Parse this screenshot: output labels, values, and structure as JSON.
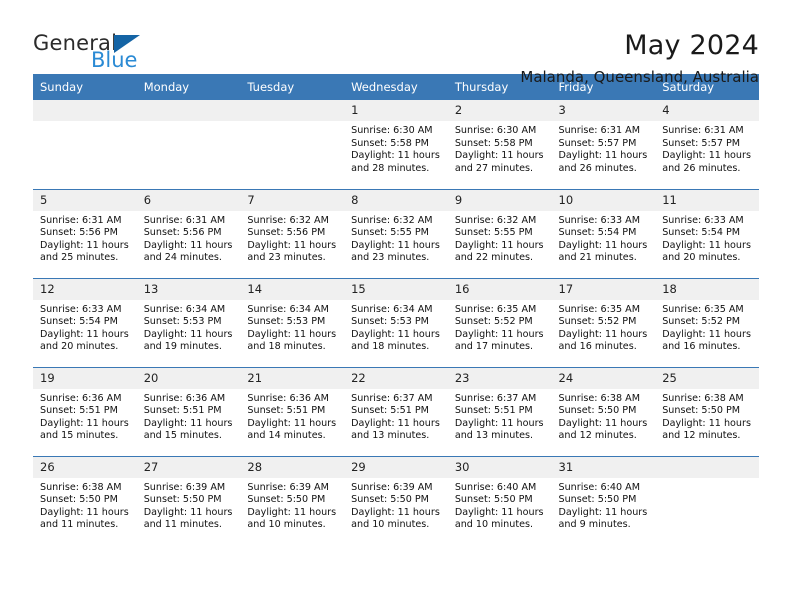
{
  "brand": {
    "name_top": "General",
    "name_bottom": "Blue",
    "triangle_color": "#1464a5",
    "blue_text_color": "#2a8ad4"
  },
  "header": {
    "title": "May 2024",
    "subtitle": "Malanda, Queensland, Australia",
    "header_bg": "#3a78b5",
    "daynum_bg": "#f0f0f0"
  },
  "weekday_headers": [
    "Sunday",
    "Monday",
    "Tuesday",
    "Wednesday",
    "Thursday",
    "Friday",
    "Saturday"
  ],
  "labels": {
    "sunrise_prefix": "Sunrise:",
    "sunset_prefix": "Sunset:",
    "daylight_prefix": "Daylight:"
  },
  "weeks": [
    [
      {
        "day": "",
        "empty": true
      },
      {
        "day": "",
        "empty": true
      },
      {
        "day": "",
        "empty": true
      },
      {
        "day": "1",
        "sunrise": "Sunrise: 6:30 AM",
        "sunset": "Sunset: 5:58 PM",
        "daylight_1": "Daylight: 11 hours",
        "daylight_2": "and 28 minutes."
      },
      {
        "day": "2",
        "sunrise": "Sunrise: 6:30 AM",
        "sunset": "Sunset: 5:58 PM",
        "daylight_1": "Daylight: 11 hours",
        "daylight_2": "and 27 minutes."
      },
      {
        "day": "3",
        "sunrise": "Sunrise: 6:31 AM",
        "sunset": "Sunset: 5:57 PM",
        "daylight_1": "Daylight: 11 hours",
        "daylight_2": "and 26 minutes."
      },
      {
        "day": "4",
        "sunrise": "Sunrise: 6:31 AM",
        "sunset": "Sunset: 5:57 PM",
        "daylight_1": "Daylight: 11 hours",
        "daylight_2": "and 26 minutes."
      }
    ],
    [
      {
        "day": "5",
        "sunrise": "Sunrise: 6:31 AM",
        "sunset": "Sunset: 5:56 PM",
        "daylight_1": "Daylight: 11 hours",
        "daylight_2": "and 25 minutes."
      },
      {
        "day": "6",
        "sunrise": "Sunrise: 6:31 AM",
        "sunset": "Sunset: 5:56 PM",
        "daylight_1": "Daylight: 11 hours",
        "daylight_2": "and 24 minutes."
      },
      {
        "day": "7",
        "sunrise": "Sunrise: 6:32 AM",
        "sunset": "Sunset: 5:56 PM",
        "daylight_1": "Daylight: 11 hours",
        "daylight_2": "and 23 minutes."
      },
      {
        "day": "8",
        "sunrise": "Sunrise: 6:32 AM",
        "sunset": "Sunset: 5:55 PM",
        "daylight_1": "Daylight: 11 hours",
        "daylight_2": "and 23 minutes."
      },
      {
        "day": "9",
        "sunrise": "Sunrise: 6:32 AM",
        "sunset": "Sunset: 5:55 PM",
        "daylight_1": "Daylight: 11 hours",
        "daylight_2": "and 22 minutes."
      },
      {
        "day": "10",
        "sunrise": "Sunrise: 6:33 AM",
        "sunset": "Sunset: 5:54 PM",
        "daylight_1": "Daylight: 11 hours",
        "daylight_2": "and 21 minutes."
      },
      {
        "day": "11",
        "sunrise": "Sunrise: 6:33 AM",
        "sunset": "Sunset: 5:54 PM",
        "daylight_1": "Daylight: 11 hours",
        "daylight_2": "and 20 minutes."
      }
    ],
    [
      {
        "day": "12",
        "sunrise": "Sunrise: 6:33 AM",
        "sunset": "Sunset: 5:54 PM",
        "daylight_1": "Daylight: 11 hours",
        "daylight_2": "and 20 minutes."
      },
      {
        "day": "13",
        "sunrise": "Sunrise: 6:34 AM",
        "sunset": "Sunset: 5:53 PM",
        "daylight_1": "Daylight: 11 hours",
        "daylight_2": "and 19 minutes."
      },
      {
        "day": "14",
        "sunrise": "Sunrise: 6:34 AM",
        "sunset": "Sunset: 5:53 PM",
        "daylight_1": "Daylight: 11 hours",
        "daylight_2": "and 18 minutes."
      },
      {
        "day": "15",
        "sunrise": "Sunrise: 6:34 AM",
        "sunset": "Sunset: 5:53 PM",
        "daylight_1": "Daylight: 11 hours",
        "daylight_2": "and 18 minutes."
      },
      {
        "day": "16",
        "sunrise": "Sunrise: 6:35 AM",
        "sunset": "Sunset: 5:52 PM",
        "daylight_1": "Daylight: 11 hours",
        "daylight_2": "and 17 minutes."
      },
      {
        "day": "17",
        "sunrise": "Sunrise: 6:35 AM",
        "sunset": "Sunset: 5:52 PM",
        "daylight_1": "Daylight: 11 hours",
        "daylight_2": "and 16 minutes."
      },
      {
        "day": "18",
        "sunrise": "Sunrise: 6:35 AM",
        "sunset": "Sunset: 5:52 PM",
        "daylight_1": "Daylight: 11 hours",
        "daylight_2": "and 16 minutes."
      }
    ],
    [
      {
        "day": "19",
        "sunrise": "Sunrise: 6:36 AM",
        "sunset": "Sunset: 5:51 PM",
        "daylight_1": "Daylight: 11 hours",
        "daylight_2": "and 15 minutes."
      },
      {
        "day": "20",
        "sunrise": "Sunrise: 6:36 AM",
        "sunset": "Sunset: 5:51 PM",
        "daylight_1": "Daylight: 11 hours",
        "daylight_2": "and 15 minutes."
      },
      {
        "day": "21",
        "sunrise": "Sunrise: 6:36 AM",
        "sunset": "Sunset: 5:51 PM",
        "daylight_1": "Daylight: 11 hours",
        "daylight_2": "and 14 minutes."
      },
      {
        "day": "22",
        "sunrise": "Sunrise: 6:37 AM",
        "sunset": "Sunset: 5:51 PM",
        "daylight_1": "Daylight: 11 hours",
        "daylight_2": "and 13 minutes."
      },
      {
        "day": "23",
        "sunrise": "Sunrise: 6:37 AM",
        "sunset": "Sunset: 5:51 PM",
        "daylight_1": "Daylight: 11 hours",
        "daylight_2": "and 13 minutes."
      },
      {
        "day": "24",
        "sunrise": "Sunrise: 6:38 AM",
        "sunset": "Sunset: 5:50 PM",
        "daylight_1": "Daylight: 11 hours",
        "daylight_2": "and 12 minutes."
      },
      {
        "day": "25",
        "sunrise": "Sunrise: 6:38 AM",
        "sunset": "Sunset: 5:50 PM",
        "daylight_1": "Daylight: 11 hours",
        "daylight_2": "and 12 minutes."
      }
    ],
    [
      {
        "day": "26",
        "sunrise": "Sunrise: 6:38 AM",
        "sunset": "Sunset: 5:50 PM",
        "daylight_1": "Daylight: 11 hours",
        "daylight_2": "and 11 minutes."
      },
      {
        "day": "27",
        "sunrise": "Sunrise: 6:39 AM",
        "sunset": "Sunset: 5:50 PM",
        "daylight_1": "Daylight: 11 hours",
        "daylight_2": "and 11 minutes."
      },
      {
        "day": "28",
        "sunrise": "Sunrise: 6:39 AM",
        "sunset": "Sunset: 5:50 PM",
        "daylight_1": "Daylight: 11 hours",
        "daylight_2": "and 10 minutes."
      },
      {
        "day": "29",
        "sunrise": "Sunrise: 6:39 AM",
        "sunset": "Sunset: 5:50 PM",
        "daylight_1": "Daylight: 11 hours",
        "daylight_2": "and 10 minutes."
      },
      {
        "day": "30",
        "sunrise": "Sunrise: 6:40 AM",
        "sunset": "Sunset: 5:50 PM",
        "daylight_1": "Daylight: 11 hours",
        "daylight_2": "and 10 minutes."
      },
      {
        "day": "31",
        "sunrise": "Sunrise: 6:40 AM",
        "sunset": "Sunset: 5:50 PM",
        "daylight_1": "Daylight: 11 hours",
        "daylight_2": "and 9 minutes."
      },
      {
        "day": "",
        "empty": true
      }
    ]
  ]
}
